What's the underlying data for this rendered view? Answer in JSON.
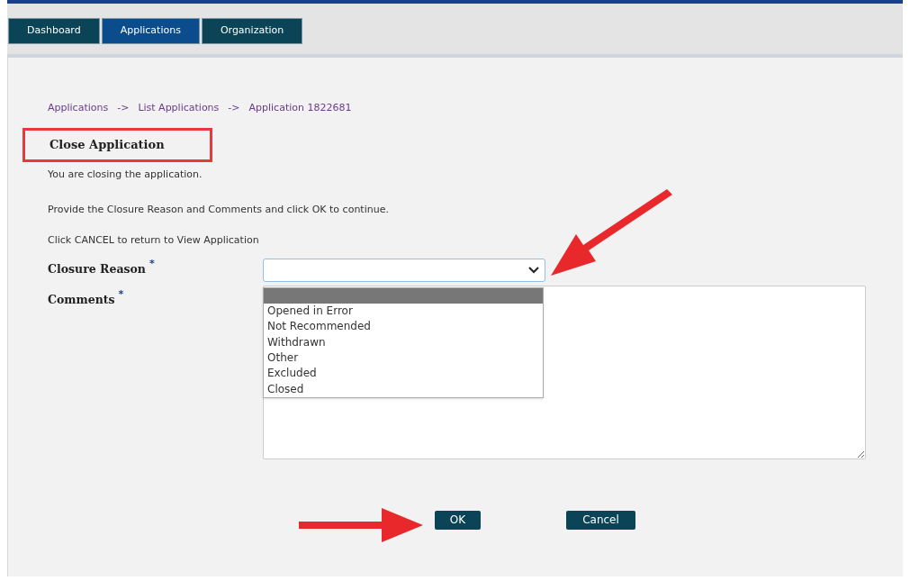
{
  "tabs": [
    {
      "label": "Dashboard",
      "selected": false
    },
    {
      "label": "Applications",
      "selected": true
    },
    {
      "label": "Organization",
      "selected": false
    }
  ],
  "breadcrumb": [
    "Applications",
    "List Applications",
    "Application 1822681"
  ],
  "breadcrumb_separator": "->",
  "heading": {
    "text": "Close Application",
    "highlighted": true
  },
  "instructions": [
    "You are closing the application.",
    "Provide the Closure Reason and Comments and click OK to continue.",
    "Click CANCEL to return to View Application"
  ],
  "form": {
    "closure_reason": {
      "label": "Closure Reason",
      "required_mark": "*",
      "expanded": true,
      "options": [
        {
          "selected": true
        },
        {
          "label": "Opened in Error",
          "selected": false
        },
        {
          "label": "Not Recommended",
          "selected": false
        },
        {
          "label": "Withdrawn",
          "selected": false
        },
        {
          "label": "Other",
          "selected": false
        },
        {
          "label": "Excluded",
          "selected": false
        },
        {
          "label": "Closed",
          "selected": false
        }
      ]
    },
    "comments": {
      "label": "Comments",
      "required_mark": "*"
    }
  },
  "buttons": [
    "OK",
    "Cancel"
  ],
  "annotations": {
    "arrow_to_select": true,
    "arrow_to_ok": true
  }
}
